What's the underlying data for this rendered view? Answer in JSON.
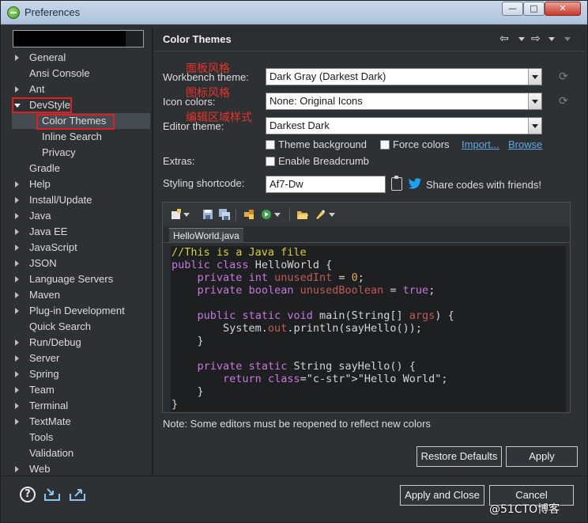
{
  "window": {
    "title": "Preferences",
    "controls": {
      "minimize": "—",
      "maximize": "□",
      "close": "✕"
    }
  },
  "filter": {
    "value": "",
    "placeholder": ""
  },
  "tree": {
    "items": [
      {
        "label": "General",
        "expandable": true
      },
      {
        "label": "Ansi Console",
        "expandable": false
      },
      {
        "label": "Ant",
        "expandable": true
      },
      {
        "label": "DevStyle",
        "expandable": true,
        "expanded": true
      },
      {
        "label": "Color Themes",
        "child": true,
        "selected": true
      },
      {
        "label": "Inline Search",
        "child": true
      },
      {
        "label": "Privacy",
        "child": true
      },
      {
        "label": "Gradle",
        "expandable": false
      },
      {
        "label": "Help",
        "expandable": true
      },
      {
        "label": "Install/Update",
        "expandable": true
      },
      {
        "label": "Java",
        "expandable": true
      },
      {
        "label": "Java EE",
        "expandable": true
      },
      {
        "label": "JavaScript",
        "expandable": true
      },
      {
        "label": "JSON",
        "expandable": true
      },
      {
        "label": "Language Servers",
        "expandable": true
      },
      {
        "label": "Maven",
        "expandable": true
      },
      {
        "label": "Plug-in Development",
        "expandable": true
      },
      {
        "label": "Quick Search",
        "expandable": false
      },
      {
        "label": "Run/Debug",
        "expandable": true
      },
      {
        "label": "Server",
        "expandable": true
      },
      {
        "label": "Spring",
        "expandable": true
      },
      {
        "label": "Team",
        "expandable": true
      },
      {
        "label": "Terminal",
        "expandable": true
      },
      {
        "label": "TextMate",
        "expandable": true
      },
      {
        "label": "Tools",
        "expandable": false
      },
      {
        "label": "Validation",
        "expandable": false
      },
      {
        "label": "Web",
        "expandable": true
      }
    ]
  },
  "page": {
    "title": "Color Themes",
    "nav": {
      "back": "⇦",
      "forward": "⇨"
    }
  },
  "annotations": {
    "panel_style": "面板风格",
    "icon_style": "图标风格",
    "editor_style": "编辑区域样式"
  },
  "form": {
    "workbench_label": "Workbench theme:",
    "workbench_value": "Dark Gray (Darkest Dark)",
    "icon_label": "Icon colors:",
    "icon_value": "None: Original Icons",
    "editor_label": "Editor theme:",
    "editor_value": "Darkest Dark",
    "theme_background": "Theme background",
    "force_colors": "Force colors",
    "import_link": "Import...",
    "browse_link": "Browse",
    "extras_label": "Extras:",
    "enable_breadcrumb": "Enable Breadcrumb",
    "shortcode_label": "Styling shortcode:",
    "shortcode_value": "Af7-Dw",
    "share_text": "Share codes with friends!"
  },
  "preview": {
    "tab_label": "HelloWorld.java",
    "code_lines": [
      "//This is a Java file",
      "public class HelloWorld {",
      "    private int unusedInt = 0;",
      "    private boolean unusedBoolean = true;",
      "",
      "    public static void main(String[] args) {",
      "        System.out.println(sayHello());",
      "    }",
      "",
      "    private static String sayHello() {",
      "        return \"Hello World\";",
      "    }",
      "}"
    ]
  },
  "note": "Note: Some editors must be reopened to reflect new colors",
  "buttons": {
    "restore_defaults": "Restore Defaults",
    "apply": "Apply",
    "apply_and_close": "Apply and Close",
    "cancel": "Cancel"
  },
  "watermark": "@51CTO博客",
  "colors": {
    "background": "#2d3134",
    "annotation_red": "#e02020",
    "link_blue": "#5fa8e6",
    "code_bg": "#1e1f20",
    "twitter_blue": "#1da1f2"
  }
}
